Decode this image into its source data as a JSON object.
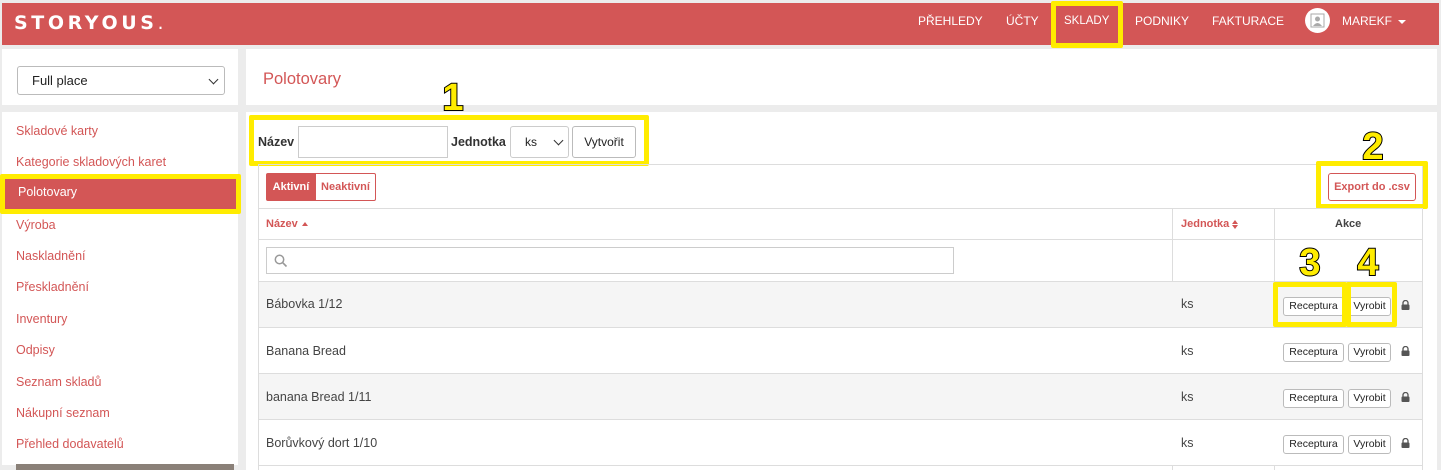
{
  "app": {
    "logo_text": "STORYOUS",
    "logo_dot": "."
  },
  "topnav": {
    "items": [
      {
        "label": "PŘEHLEDY"
      },
      {
        "label": "ÚČTY"
      },
      {
        "label": "SKLADY",
        "active": true
      },
      {
        "label": "PODNIKY"
      },
      {
        "label": "FAKTURACE"
      }
    ],
    "user": "MAREKF"
  },
  "sidebar": {
    "place_select": "Full place",
    "items": [
      {
        "label": "Skladové karty"
      },
      {
        "label": "Kategorie skladových karet"
      },
      {
        "label": "Polotovary",
        "active": true
      },
      {
        "label": "Výroba"
      },
      {
        "label": "Naskladnění"
      },
      {
        "label": "Přeskladnění"
      },
      {
        "label": "Inventury"
      },
      {
        "label": "Odpisy"
      },
      {
        "label": "Seznam skladů"
      },
      {
        "label": "Nákupní seznam"
      },
      {
        "label": "Přehled dodavatelů"
      }
    ]
  },
  "page": {
    "title": "Polotovary"
  },
  "form": {
    "name_label": "Název",
    "name_value": "",
    "unit_label": "Jednotka",
    "unit_value": "ks",
    "create_label": "Vytvořit"
  },
  "filters": {
    "active": "Aktivní",
    "inactive": "Neaktivní"
  },
  "export_label": "Export do .csv",
  "table": {
    "headers": {
      "name": "Název",
      "unit": "Jednotka",
      "actions": "Akce"
    },
    "rows": [
      {
        "name": "Bábovka 1/12",
        "unit": "ks"
      },
      {
        "name": "Banana Bread",
        "unit": "ks"
      },
      {
        "name": "banana Bread 1/11",
        "unit": "ks"
      },
      {
        "name": "Borůvkový dort 1/10",
        "unit": "ks"
      }
    ],
    "recipe_label": "Receptura",
    "produce_label": "Vyrobit"
  },
  "annotations": {
    "n1": "1",
    "n2": "2",
    "n3": "3",
    "n4": "4"
  },
  "colors": {
    "brand": "#d35656",
    "highlight": "#ffec00"
  }
}
